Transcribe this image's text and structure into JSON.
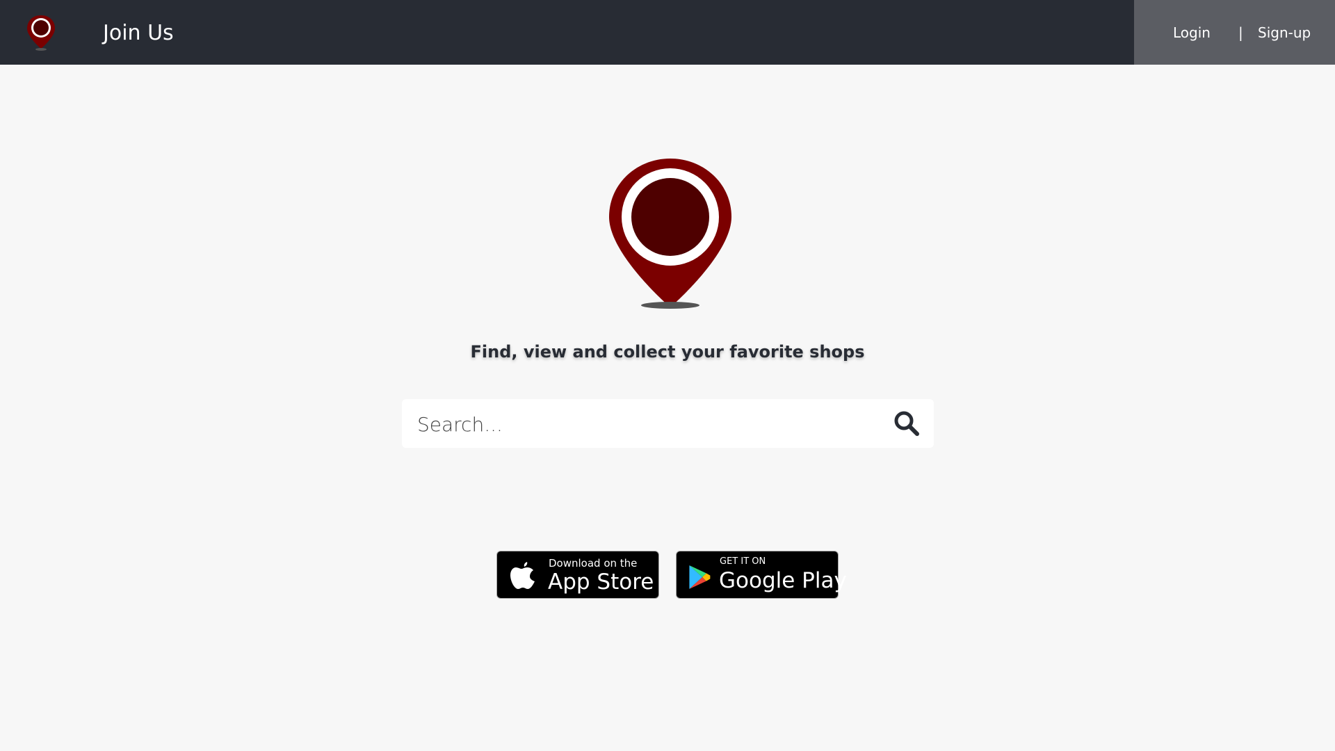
{
  "nav": {
    "title": "Join Us",
    "login_label": "Login",
    "separator": "|",
    "signup_label": "Sign-up"
  },
  "hero": {
    "tagline": "Find, view and collect your favorite shops"
  },
  "search": {
    "placeholder": "Search..."
  },
  "badges": {
    "appstore_small": "Download on the",
    "appstore_big": "App Store",
    "google_small": "GET IT ON",
    "google_big": "Google Play"
  },
  "colors": {
    "navbar": "#282c34",
    "auth_area": "#5b5d63",
    "pin_red": "#7b0000",
    "pin_core": "#4e0000",
    "background": "#f7f7f7"
  }
}
